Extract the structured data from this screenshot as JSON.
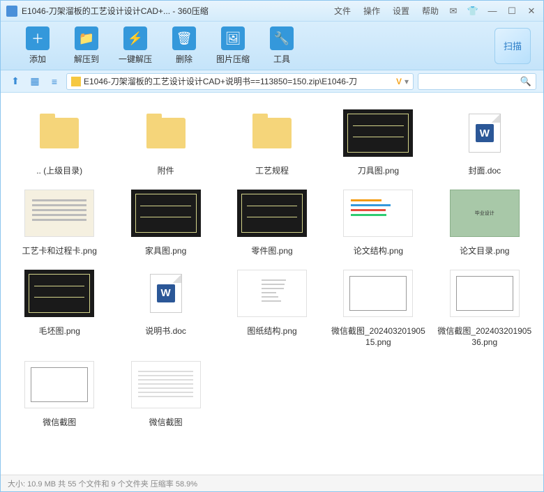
{
  "titlebar": {
    "title": "E1046-刀架溜板的工艺设计设计CAD+... - 360压缩",
    "menus": [
      "文件",
      "操作",
      "设置",
      "帮助"
    ]
  },
  "toolbar": {
    "buttons": [
      {
        "label": "添加",
        "color": "#3498db",
        "glyph": "＋"
      },
      {
        "label": "解压到",
        "color": "#3498db",
        "glyph": "📁"
      },
      {
        "label": "一键解压",
        "color": "#3498db",
        "glyph": "⚡"
      },
      {
        "label": "删除",
        "color": "#3498db",
        "glyph": "🗑"
      },
      {
        "label": "图片压缩",
        "color": "#3498db",
        "glyph": "🖼"
      },
      {
        "label": "工具",
        "color": "#3498db",
        "glyph": "🔧"
      }
    ],
    "scan": "扫描"
  },
  "navbar": {
    "path": "E1046-刀架溜板的工艺设计设计CAD+说明书==113850=150.zip\\E1046-刀",
    "path_suffix": "V"
  },
  "files": [
    {
      "name": ".. (上级目录)",
      "type": "folder"
    },
    {
      "name": "附件",
      "type": "folder"
    },
    {
      "name": "工艺规程",
      "type": "folder"
    },
    {
      "name": "刀具图.png",
      "type": "cad"
    },
    {
      "name": "封面.doc",
      "type": "doc"
    },
    {
      "name": "工艺卡和过程卡.png",
      "type": "form"
    },
    {
      "name": "家具图.png",
      "type": "cad"
    },
    {
      "name": "零件图.png",
      "type": "cad"
    },
    {
      "name": "论文结构.png",
      "type": "colorbars"
    },
    {
      "name": "论文目录.png",
      "type": "green"
    },
    {
      "name": "毛坯图.png",
      "type": "cad"
    },
    {
      "name": "说明书.doc",
      "type": "doc"
    },
    {
      "name": "图纸结构.png",
      "type": "listtext"
    },
    {
      "name": "微信截图_20240320190515.png",
      "type": "drawing"
    },
    {
      "name": "微信截图_20240320190536.png",
      "type": "drawing"
    },
    {
      "name": "微信截图",
      "type": "drawing"
    },
    {
      "name": "微信截图",
      "type": "texttext"
    }
  ],
  "statusbar": {
    "text": "大小: 10.9 MB 共 55 个文件和 9 个文件夹 压缩率 58.9%"
  }
}
